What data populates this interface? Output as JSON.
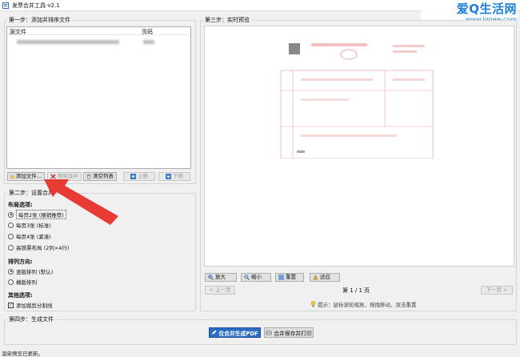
{
  "window": {
    "title": "发票合并工具-v2.1"
  },
  "watermark": {
    "brand": "爱Q生活网",
    "url": "www.iqnew.com"
  },
  "step1": {
    "title": "第一步：添加并排序文件",
    "columns": {
      "file": "源文件",
      "pages": "页码"
    },
    "buttons": {
      "add": "添加文件...",
      "remove": "移除选中",
      "clear": "清空列表",
      "up": "上移",
      "down": "下移"
    }
  },
  "step2": {
    "title": "第二步：设置合并",
    "layout_label": "布局选项:",
    "layout_options": [
      "每页2张 (报销推荐)",
      "每页3张 (标准)",
      "每页4张 (紧凑)",
      "高铁票布局 (2列×4行)"
    ],
    "layout_selected": 0,
    "direction_label": "排列方向:",
    "direction_options": [
      "竖版排列 (默认)",
      "横版排列"
    ],
    "direction_selected": 0,
    "other_label": "其他选项:",
    "cut_line_label": "添加裁剪分割线",
    "cut_line_checked": true
  },
  "step3": {
    "title": "第三步：实时预览",
    "zoom_in": "放大",
    "zoom_out": "缩小",
    "reset": "重置",
    "fit": "适应",
    "prev_page": "< 上一页",
    "next_page": "下一页 >",
    "page_indicator": "第 1 / 1 页",
    "tip": "提示：鼠标滚轮缩放，拖拽移动，双击重置"
  },
  "step4": {
    "title": "第四步：生成文件",
    "merge_pdf": "仅合并生成PDF",
    "merge_print": "合并保存并打印"
  },
  "status": {
    "text": "渲染预览已更新。"
  },
  "colors": {
    "accent": "#2b6cc4",
    "arrow": "#e8302a",
    "invoice_red": "#d9534f"
  }
}
